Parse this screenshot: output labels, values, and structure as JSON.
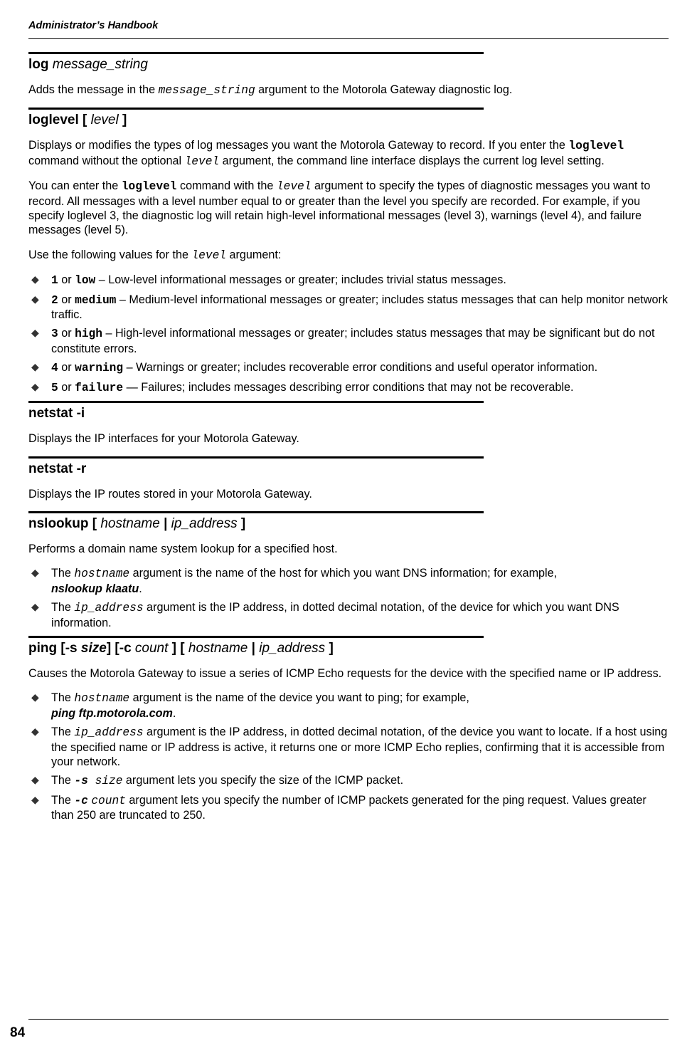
{
  "page": {
    "running_header": "Administrator’s Handbook",
    "page_number": "84"
  },
  "doc": {
    "log": {
      "heading_pre": "log",
      "heading_arg": "message_string",
      "desc_pre": "Adds the message in the ",
      "desc_code": "message_string",
      "desc_post": " argument to the Motorola Gateway diagnostic log."
    },
    "loglevel": {
      "heading_a": "loglevel [",
      "heading_arg": "level",
      "heading_b": "]",
      "d1_a": "Displays or modifies the types of log messages you want the Motorola Gateway to record. If you enter the ",
      "d1_code": "loglevel",
      "d1_b": " command without the optional ",
      "d1_code2": "level",
      "d1_c": " argument, the command line interface displays the current log level setting.",
      "d2_a": "You can enter the ",
      "d2_code": "loglevel",
      "d2_b": " command with the ",
      "d2_code2": "level",
      "d2_c": " argument to specify the types of diagnostic messages you want to record. All messages with a level number equal to or greater than the level you specify are recorded. For example, if you specify loglevel 3, the diagnostic log will retain high-level informational messages (level 3), warnings (level 4), and failure messages (level 5).",
      "d3_a": "Use the following values for the ",
      "d3_code": "level",
      "d3_b": " argument:",
      "items": [
        {
          "num": "1",
          "sep": " or ",
          "kw": "low",
          "rest": " – Low-level informational messages or greater; includes trivial status messages."
        },
        {
          "num": "2",
          "sep": " or ",
          "kw": "medium",
          "rest": " – Medium-level informational messages or greater; includes status messages that can help monitor network traffic."
        },
        {
          "num": "3",
          "sep": " or ",
          "kw": "high",
          "rest": " – High-level informational messages or greater; includes status messages that may be significant but do not constitute errors."
        },
        {
          "num": "4",
          "sep": " or ",
          "kw": "warning",
          "rest": "  – Warnings or greater; includes recoverable error conditions and useful operator information."
        },
        {
          "num": "5",
          "sep": " or ",
          "kw": "failure",
          "rest": " —  Failures; includes messages describing error conditions that may not be recoverable."
        }
      ]
    },
    "netstat_i": {
      "heading": "netstat -i",
      "desc": "Displays the IP interfaces for your Motorola Gateway."
    },
    "netstat_r": {
      "heading": "netstat -r",
      "desc": "Displays the IP routes stored in your Motorola Gateway."
    },
    "nslookup": {
      "heading_a": "nslookup [",
      "heading_arg1": "hostname",
      "heading_sep": " | ",
      "heading_arg2": "ip_address",
      "heading_b": "]",
      "desc": "Performs a domain name system lookup for a specified host.",
      "item1_a": "The ",
      "item1_code": "hostname",
      "item1_b": " argument is the name of the host for which you want DNS information; for example, ",
      "item1_ex": "nslookup klaatu",
      "item1_c": ".",
      "item2_a": "The ",
      "item2_code": "ip_address",
      "item2_b": " argument is the IP address, in dotted decimal notation, of the device for which you want DNS information."
    },
    "ping": {
      "heading_a": "ping [-s",
      "heading_arg_size": "size",
      "heading_b": "] [-c",
      "heading_arg_count": "count",
      "heading_c": " ] [",
      "heading_arg_host": "hostname",
      "heading_sep": " | ",
      "heading_arg_ip": "ip_address",
      "heading_d": "]",
      "desc": "Causes the Motorola Gateway to issue a series of ICMP Echo requests for the device with the specified name or IP address.",
      "item1_a": "The ",
      "item1_code": "hostname",
      "item1_b": " argument is the name of the device you want to ping; for example, ",
      "item1_ex": "ping ftp.motorola.com",
      "item1_c": ".",
      "item2_a": "The ",
      "item2_code": "ip_address",
      "item2_b": " argument is the IP address, in dotted decimal notation, of the device you want to locate. If a host using the specified name or IP address is active, it returns one or more ICMP Echo replies, confirming that it is accessible from your network.",
      "item3_a": "The ",
      "item3_flag": "-s",
      "item3_sp": "  ",
      "item3_arg": "size",
      "item3_b": " argument lets you specify the size of the ICMP packet.",
      "item4_a": "The ",
      "item4_flag": "-c",
      "item4_arg": "count",
      "item4_b": " argument lets you specify the number of ICMP packets generated for the ping request. Values greater than 250 are truncated to 250."
    }
  }
}
